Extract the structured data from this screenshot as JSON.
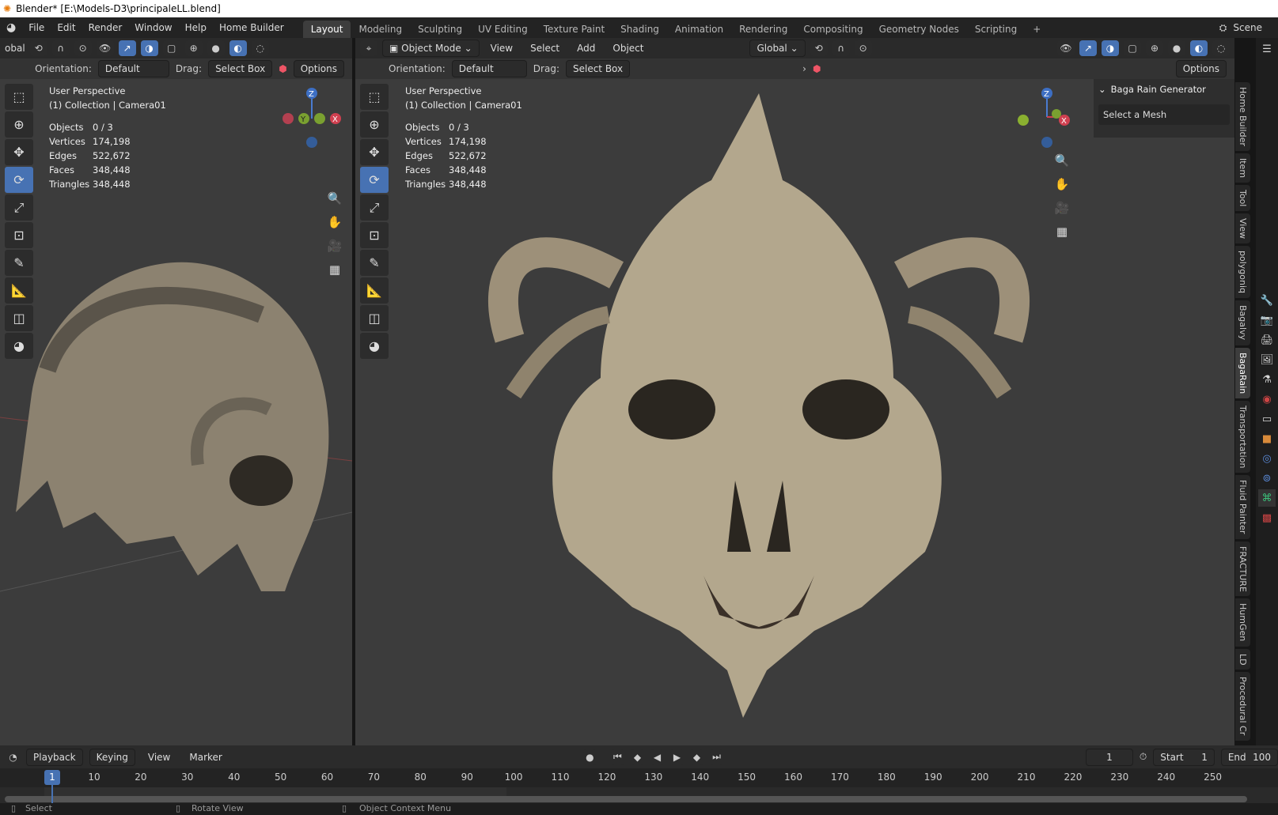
{
  "title": "Blender* [E:\\Models-D3\\principaleLL.blend]",
  "menu": [
    "File",
    "Edit",
    "Render",
    "Window",
    "Help",
    "Home Builder"
  ],
  "workspaces": [
    "Layout",
    "Modeling",
    "Sculpting",
    "UV Editing",
    "Texture Paint",
    "Shading",
    "Animation",
    "Rendering",
    "Compositing",
    "Geometry Nodes",
    "Scripting",
    "+"
  ],
  "scene": "Scene",
  "left_view": {
    "transform": "obal",
    "orientation_label": "Orientation:",
    "orientation": "Default",
    "drag_label": "Drag:",
    "drag": "Select Box",
    "options": "Options",
    "perspective": "User Perspective",
    "collection": "(1) Collection | Camera01"
  },
  "right_view": {
    "mode": "Object Mode",
    "menus": [
      "View",
      "Select",
      "Add",
      "Object"
    ],
    "transform": "Global",
    "orientation_label": "Orientation:",
    "orientation": "Default",
    "drag_label": "Drag:",
    "drag": "Select Box",
    "options": "Options",
    "perspective": "User Perspective",
    "collection": "(1) Collection | Camera01"
  },
  "stats": [
    [
      "Objects",
      "0 / 3"
    ],
    [
      "Vertices",
      "174,198"
    ],
    [
      "Edges",
      "522,672"
    ],
    [
      "Faces",
      "348,448"
    ],
    [
      "Triangles",
      "348,448"
    ]
  ],
  "gizmo": {
    "z": "Z",
    "y": "Y",
    "x": "X"
  },
  "panel": {
    "title": "Baga Rain Generator",
    "field": "Select a Mesh"
  },
  "side_tabs": [
    "Home Builder",
    "Item",
    "Tool",
    "View",
    "polygoniq",
    "Bagalvy",
    "BagaRain",
    "Transportation",
    "Fluid Painter",
    "FRACTURE",
    "HumGen",
    "LD",
    "Procedural Cr"
  ],
  "timeline": {
    "menus": [
      "Playback",
      "Keying",
      "View",
      "Marker"
    ],
    "current_frame": "1",
    "start_label": "Start",
    "start": "1",
    "end_label": "End",
    "end": "100",
    "ticks": [
      "10",
      "20",
      "30",
      "40",
      "50",
      "60",
      "70",
      "80",
      "90",
      "100",
      "110",
      "120",
      "130",
      "140",
      "150",
      "160",
      "170",
      "180",
      "190",
      "200",
      "210",
      "220",
      "230",
      "240",
      "250"
    ]
  },
  "status": [
    "Select",
    "Rotate View",
    "Object Context Menu"
  ]
}
